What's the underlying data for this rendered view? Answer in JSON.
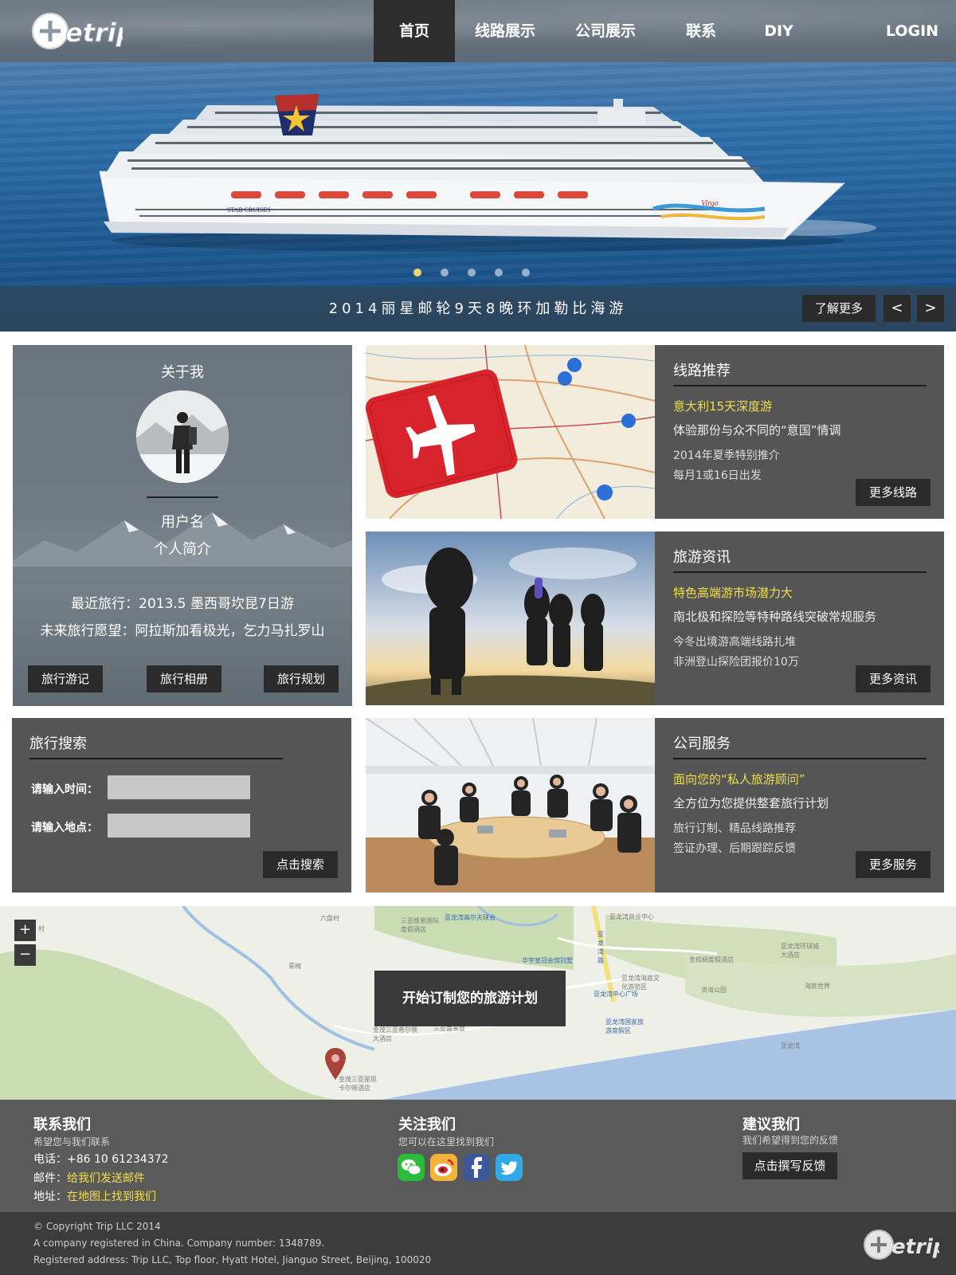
{
  "nav": {
    "logo_text": "etrip",
    "items": [
      {
        "label": "首页",
        "active": true
      },
      {
        "label": "线路展示",
        "active": false
      },
      {
        "label": "公司展示",
        "active": false
      },
      {
        "label": "联系",
        "active": false
      },
      {
        "label": "DIY",
        "active": false
      }
    ],
    "login_label": "LOGIN"
  },
  "hero": {
    "ship_name_label": "STAR CRUISES",
    "ship_brand": "Virgo",
    "caption": "2014丽星邮轮9天8晚环加勒比海游",
    "learn_more_label": "了解更多",
    "prev_label": "<",
    "next_label": ">",
    "slide_count": 5,
    "active_slide": 1
  },
  "about": {
    "title": "关于我",
    "username": "用户名",
    "bio": "个人简介",
    "recent_trip": "最近旅行：2013.5 墨西哥坎昆7日游",
    "future_wish": "未来旅行愿望：阿拉斯加看极光，乞力马扎罗山",
    "buttons": [
      "旅行游记",
      "旅行相册",
      "旅行规划"
    ]
  },
  "routes": {
    "title": "线路推荐",
    "highlight": "意大利15天深度游",
    "desc": "体验那份与众不同的“意国”情调",
    "line1": "2014年夏季特别推介",
    "line2": "每月1或16日出发",
    "more_label": "更多线路"
  },
  "news": {
    "title": "旅游资讯",
    "highlight": "特色高端游市场潜力大",
    "desc": "南北极和探险等特种路线突破常规服务",
    "line1": "今冬出境游高端线路扎堆",
    "line2": "非洲登山探险团报价10万",
    "more_label": "更多资讯"
  },
  "search": {
    "title": "旅行搜索",
    "time_label": "请输入时间：",
    "place_label": "请输入地点：",
    "time_value": "",
    "place_value": "",
    "submit_label": "点击搜索"
  },
  "services": {
    "title": "公司服务",
    "highlight": "面向您的“私人旅游顾问”",
    "desc": "全方位为您提供整套旅行计划",
    "line1": "旅行订制、精品线路推荐",
    "line2": "签证办理、后期跟踪反馈",
    "more_label": "更多服务"
  },
  "map": {
    "zoom_in": "+",
    "zoom_out": "−",
    "cta": "开始订制您的旅游计划",
    "labels": {
      "liuhe": "六盘村",
      "qingmei": "青梅",
      "cun": "村",
      "resort1": "三亚维景国际度假酒店",
      "golf": "亚龙湾高尔夫球会",
      "center": "亚龙湾商业中心",
      "road": "亚龙湾路",
      "huayu": "华宇皇冠会馆别墅",
      "jinmao": "金茂三亚希尔顿大酒店",
      "ritz": "金茂三亚丽思卡尔顿酒店",
      "plaza": "亚龙湾中心广场",
      "park": "亚龙湾国家旅游度假区",
      "culture": "亚龙湾海底文化游览区",
      "marriott": "三亚喜来登",
      "ring": "亚龙湾环球城大酒店",
      "pines": "金棕榈度假酒店",
      "haiwei": "海底世界",
      "beach": "滨海公园",
      "sea": "亚龙湾"
    }
  },
  "footer": {
    "contact": {
      "title": "联系我们",
      "sub": "希望您与我们联系",
      "phone_label": "电话：",
      "phone": "+86 10 61234372",
      "mail_label": "邮件：",
      "mail_link": "给我们发送邮件",
      "addr_label": "地址：",
      "addr_link": "在地图上找到我们"
    },
    "follow": {
      "title": "关注我们",
      "sub": "您可以在这里找到我们",
      "icons": [
        "wechat-icon",
        "weibo-icon",
        "facebook-icon",
        "twitter-icon"
      ]
    },
    "suggest": {
      "title": "建议我们",
      "sub": "我们希望得到您的反馈",
      "button": "点击撰写反馈"
    },
    "copyright": "© Copyright Trip LLC 2014",
    "company": "A company registered in China. Company number: 1348789.",
    "address": "Registered address: Trip LLC, Top floor, Hyatt Hotel, Jianguo Street, Beijing, 100020",
    "logo_text": "etrip"
  },
  "colors": {
    "panel_bg": "#555555",
    "highlight": "#f2df4a",
    "button_dark": "#2b2b2b",
    "footer_top": "#5a5a5a",
    "footer_bottom": "#3c3c3c"
  }
}
